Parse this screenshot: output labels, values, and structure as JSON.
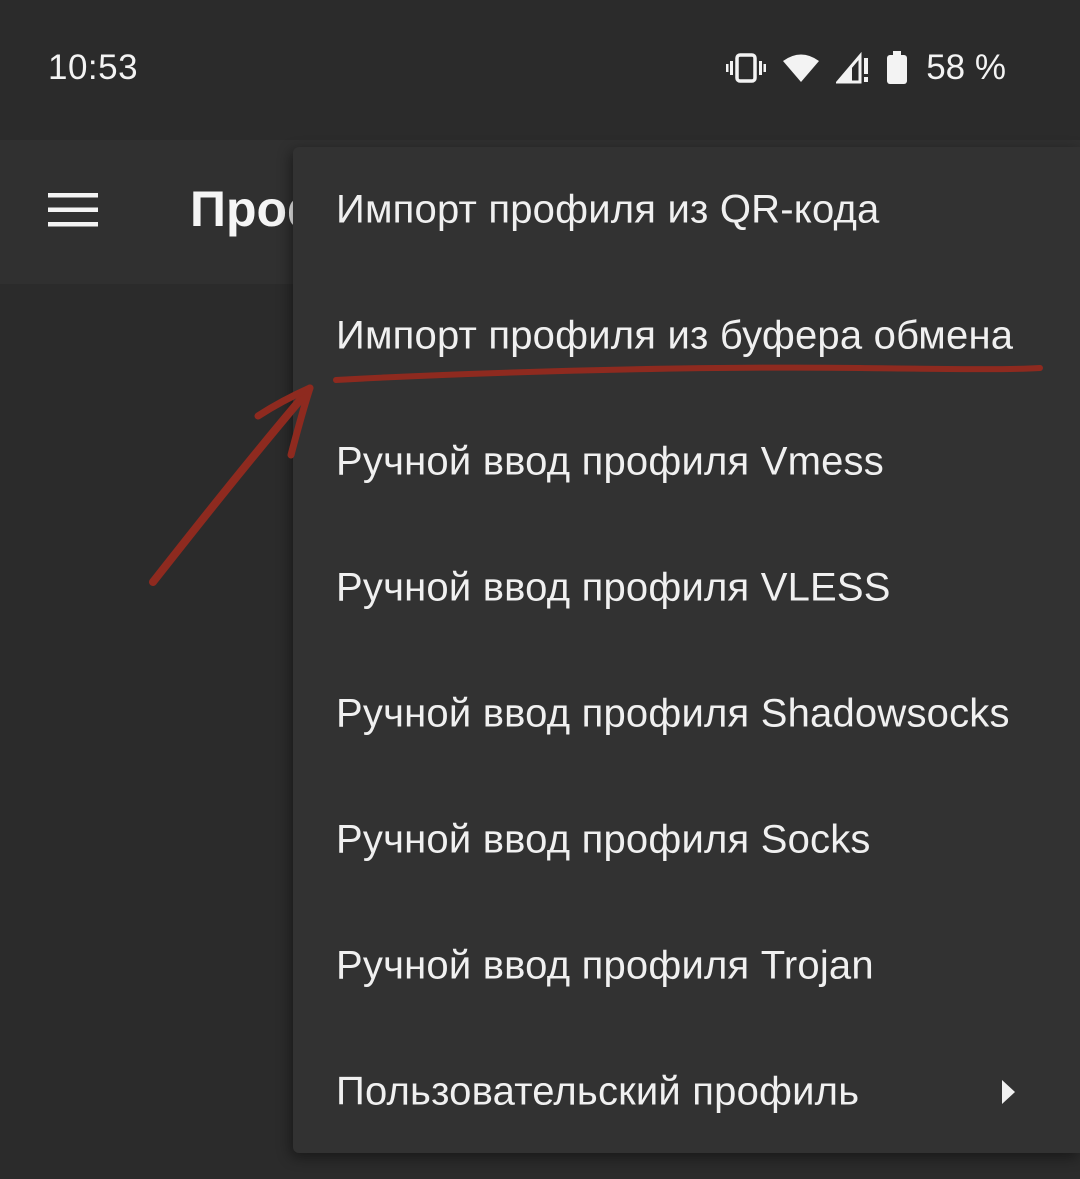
{
  "status_bar": {
    "time": "10:53",
    "battery": "58 %",
    "icons": [
      "vibrate-icon",
      "wifi-icon",
      "signal-icon",
      "battery-icon"
    ]
  },
  "app_bar": {
    "title": "Проф",
    "menu_icon": "hamburger-menu-icon"
  },
  "menu": {
    "items": [
      {
        "label": "Импорт профиля из QR-кода"
      },
      {
        "label": "Импорт профиля из буфера обмена"
      },
      {
        "label": "Ручной ввод профиля Vmess"
      },
      {
        "label": "Ручной ввод профиля VLESS"
      },
      {
        "label": "Ручной ввод профиля Shadowsocks"
      },
      {
        "label": "Ручной ввод профиля Socks"
      },
      {
        "label": "Ручной ввод профиля Trojan"
      },
      {
        "label": "Пользовательский профиль",
        "submenu_icon": "chevron-right-icon"
      }
    ]
  },
  "annotation": {
    "color": "#8e2a1f",
    "target_item": "Импорт профиля из буфера обмена"
  }
}
